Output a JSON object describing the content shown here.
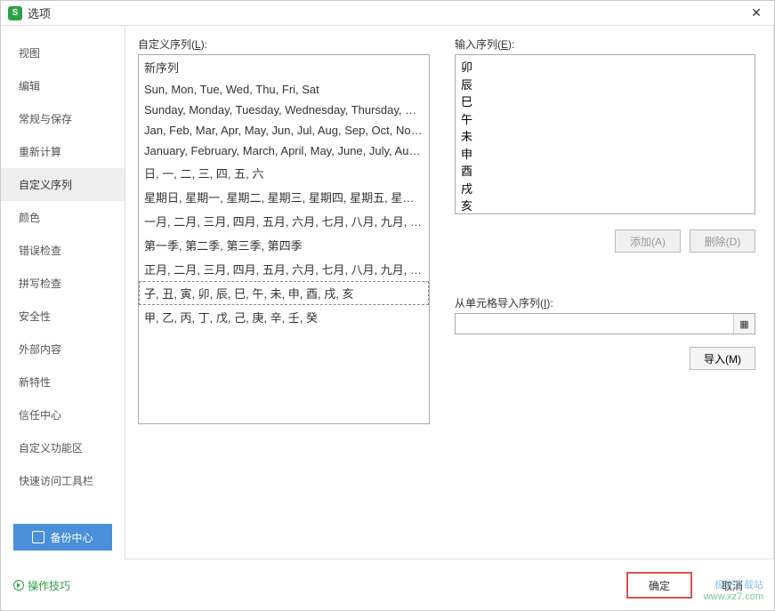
{
  "title": "选项",
  "app_icon_letter": "S",
  "sidebar": {
    "items": [
      {
        "label": "视图"
      },
      {
        "label": "编辑"
      },
      {
        "label": "常规与保存"
      },
      {
        "label": "重新计算"
      },
      {
        "label": "自定义序列"
      },
      {
        "label": "颜色"
      },
      {
        "label": "错误检查"
      },
      {
        "label": "拼写检查"
      },
      {
        "label": "安全性"
      },
      {
        "label": "外部内容"
      },
      {
        "label": "新特性"
      },
      {
        "label": "信任中心"
      },
      {
        "label": "自定义功能区"
      },
      {
        "label": "快速访问工具栏"
      }
    ],
    "active_index": 4,
    "backup_label": "备份中心"
  },
  "left": {
    "label_prefix": "自定义序列(",
    "label_key": "L",
    "label_suffix": "):",
    "list": [
      "新序列",
      "Sun, Mon, Tue, Wed, Thu, Fri, Sat",
      "Sunday, Monday, Tuesday, Wednesday, Thursday, Frid...",
      "Jan, Feb, Mar, Apr, May, Jun, Jul, Aug, Sep, Oct, Nov, ...",
      "January, February, March, April, May, June, July, Augus...",
      "日, 一, 二, 三, 四, 五, 六",
      "星期日, 星期一, 星期二, 星期三, 星期四, 星期五, 星期六",
      "一月, 二月, 三月, 四月, 五月, 六月, 七月, 八月, 九月, 十月, ...",
      "第一季, 第二季, 第三季, 第四季",
      "正月, 二月, 三月, 四月, 五月, 六月, 七月, 八月, 九月, 十月, ...",
      "子, 丑, 寅, 卯, 辰, 巳, 午, 未, 申, 酉, 戌, 亥",
      "甲, 乙, 丙, 丁, 戊, 己, 庚, 辛, 壬, 癸"
    ],
    "selected_index": 10
  },
  "right": {
    "input_label_prefix": "输入序列(",
    "input_label_key": "E",
    "input_label_suffix": "):",
    "input_value": "卯\n辰\n巳\n午\n未\n申\n酉\n戌\n亥",
    "add_label": "添加(A)",
    "delete_label": "删除(D)",
    "import_label_prefix": "从单元格导入序列(",
    "import_label_key": "I",
    "import_label_suffix": "):",
    "import_value": "",
    "import_button": "导入(M)"
  },
  "footer": {
    "tips_label": "操作技巧",
    "ok_label": "确定",
    "cancel_label": "取消"
  },
  "watermark": {
    "line1": "极光下载站",
    "line2": "www.xz7.com"
  }
}
